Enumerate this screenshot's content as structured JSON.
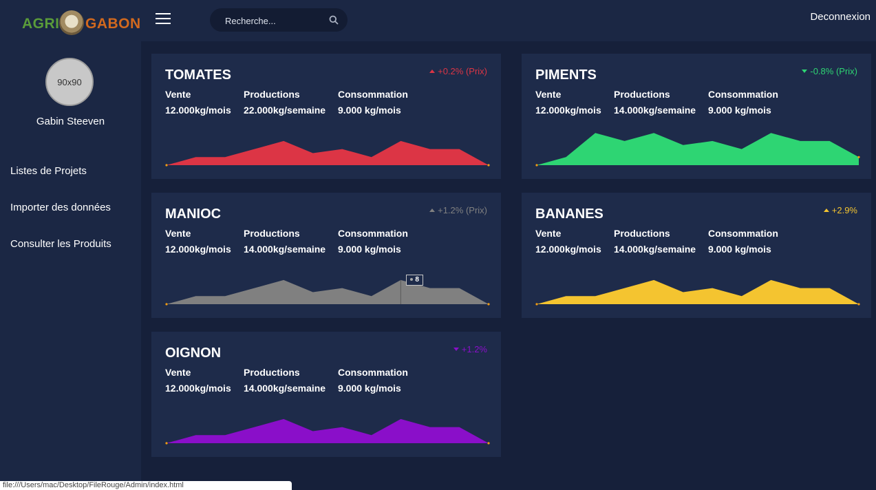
{
  "brand": {
    "part1": "AGRI",
    "part2": "GABON"
  },
  "header": {
    "search_placeholder": "Recherche...",
    "logout_label": "Deconnexion"
  },
  "user": {
    "avatar_text": "90x90",
    "name": "Gabin Steeven"
  },
  "sidebar": {
    "items": [
      {
        "label": "Listes de Projets"
      },
      {
        "label": "Importer des données"
      },
      {
        "label": "Consulter les Produits"
      }
    ]
  },
  "labels": {
    "vente": "Vente",
    "productions": "Productions",
    "consommation": "Consommation"
  },
  "cards": [
    {
      "title": "TOMATES",
      "trend": "+0.2% (Prix)",
      "trend_dir": "up",
      "color": "#dc3545",
      "vente": "12.000kg/mois",
      "productions": "22.000kg/semaine",
      "consommation": "9.000 kg/mois",
      "sparkline": [
        0,
        2,
        2,
        4,
        6,
        3,
        4,
        2,
        6,
        4,
        4,
        0
      ]
    },
    {
      "title": "PIMENTS",
      "trend": "-0.8% (Prix)",
      "trend_dir": "down",
      "color": "#2ed573",
      "vente": "12.000kg/mois",
      "productions": "14.000kg/semaine",
      "consommation": "9.000 kg/mois",
      "sparkline": [
        0,
        2,
        8,
        6,
        8,
        5,
        6,
        4,
        8,
        6,
        6,
        2
      ]
    },
    {
      "title": "MANIOC",
      "trend": "+1.2% (Prix)",
      "trend_dir": "up",
      "color": "#808080",
      "vente": "12.000kg/mois",
      "productions": "14.000kg/semaine",
      "consommation": "9.000 kg/mois",
      "sparkline": [
        0,
        2,
        2,
        4,
        6,
        3,
        4,
        2,
        6,
        4,
        4,
        0
      ],
      "tooltip": "8"
    },
    {
      "title": "BANANES",
      "trend": "+2.9%",
      "trend_dir": "up",
      "color": "#f4c430",
      "vente": "12.000kg/mois",
      "productions": "14.000kg/semaine",
      "consommation": "9.000 kg/mois",
      "sparkline": [
        0,
        2,
        2,
        4,
        6,
        3,
        4,
        2,
        6,
        4,
        4,
        0
      ]
    },
    {
      "title": "OIGNON",
      "trend": "+1.2%",
      "trend_dir": "down",
      "color": "#8a0fc9",
      "vente": "12.000kg/mois",
      "productions": "14.000kg/semaine",
      "consommation": "9.000 kg/mois",
      "sparkline": [
        0,
        2,
        2,
        4,
        6,
        3,
        4,
        2,
        6,
        4,
        4,
        0
      ]
    }
  ],
  "statusbar": "file:///Users/mac/Desktop/FileRouge/Admin/index.html"
}
